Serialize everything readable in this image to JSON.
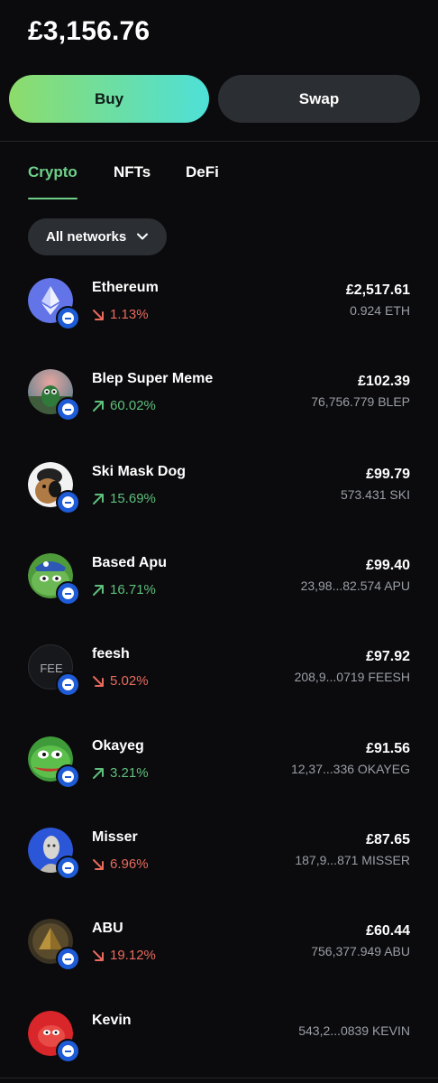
{
  "balance": "£3,156.76",
  "actions": {
    "buy_label": "Buy",
    "swap_label": "Swap"
  },
  "tabs": [
    {
      "label": "Crypto",
      "active": true
    },
    {
      "label": "NFTs",
      "active": false
    },
    {
      "label": "DeFi",
      "active": false
    }
  ],
  "network_filter": {
    "label": "All networks"
  },
  "colors": {
    "accent": "#6fd08a",
    "up": "#5fbf7c",
    "down": "#ea6a5e",
    "badge": "#1e5bd7"
  },
  "tokens": [
    {
      "name": "Ethereum",
      "change": "1.13%",
      "direction": "down",
      "fiat": "£2,517.61",
      "amount": "0.924 ETH",
      "icon": "ethereum-icon"
    },
    {
      "name": "Blep Super Meme",
      "change": "60.02%",
      "direction": "up",
      "fiat": "£102.39",
      "amount": "76,756.779 BLEP",
      "icon": "blep-icon"
    },
    {
      "name": "Ski Mask Dog",
      "change": "15.69%",
      "direction": "up",
      "fiat": "£99.79",
      "amount": "573.431 SKI",
      "icon": "ski-mask-dog-icon"
    },
    {
      "name": "Based Apu",
      "change": "16.71%",
      "direction": "up",
      "fiat": "£99.40",
      "amount": "23,98...82.574 APU",
      "icon": "based-apu-icon"
    },
    {
      "name": "feesh",
      "change": "5.02%",
      "direction": "down",
      "fiat": "£97.92",
      "amount": "208,9...0719 FEESH",
      "icon": "feesh-icon",
      "placeholder": "FEE"
    },
    {
      "name": "Okayeg",
      "change": "3.21%",
      "direction": "up",
      "fiat": "£91.56",
      "amount": "12,37...336 OKAYEG",
      "icon": "okayeg-icon"
    },
    {
      "name": "Misser",
      "change": "6.96%",
      "direction": "down",
      "fiat": "£87.65",
      "amount": "187,9...871 MISSER",
      "icon": "misser-icon"
    },
    {
      "name": "ABU",
      "change": "19.12%",
      "direction": "down",
      "fiat": "£60.44",
      "amount": "756,377.949 ABU",
      "icon": "abu-icon"
    },
    {
      "name": "Kevin",
      "change": "",
      "direction": "",
      "fiat": "",
      "amount": "543,2...0839 KEVIN",
      "icon": "kevin-icon"
    }
  ]
}
